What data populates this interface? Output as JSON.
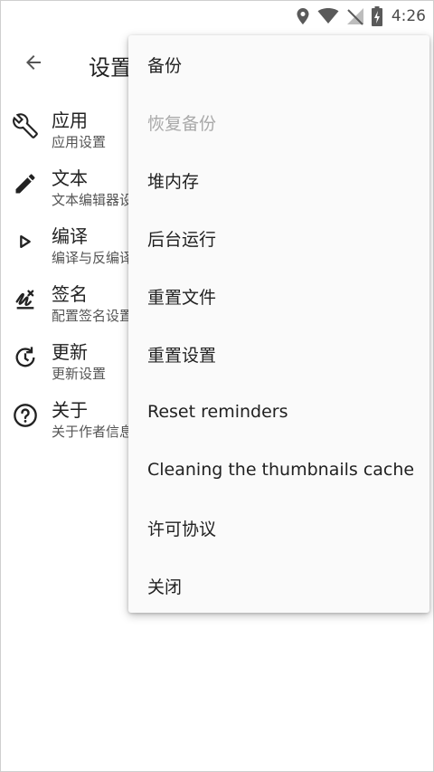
{
  "status_bar": {
    "time": "4:26",
    "icons": [
      "location-icon",
      "wifi-icon",
      "no-signal-icon",
      "battery-charging-icon"
    ]
  },
  "app_bar": {
    "back_icon": "arrow-back-icon",
    "title": "设置"
  },
  "settings": [
    {
      "icon": "wrench-icon",
      "title": "应用",
      "subtitle": "应用设置"
    },
    {
      "icon": "pencil-icon",
      "title": "文本",
      "subtitle": "文本编辑器设置"
    },
    {
      "icon": "play-icon",
      "title": "编译",
      "subtitle": "编译与反编译"
    },
    {
      "icon": "signature-icon",
      "title": "签名",
      "subtitle": "配置签名设置"
    },
    {
      "icon": "update-icon",
      "title": "更新",
      "subtitle": "更新设置"
    },
    {
      "icon": "help-icon",
      "title": "关于",
      "subtitle": "关于作者信息"
    }
  ],
  "menu": {
    "items": [
      {
        "label": "备份",
        "enabled": true
      },
      {
        "label": "恢复备份",
        "enabled": false
      },
      {
        "label": "堆内存",
        "enabled": true
      },
      {
        "label": "后台运行",
        "enabled": true
      },
      {
        "label": "重置文件",
        "enabled": true
      },
      {
        "label": "重置设置",
        "enabled": true
      },
      {
        "label": "Reset reminders",
        "enabled": true
      },
      {
        "label": "Cleaning the thumbnails cache",
        "enabled": true
      },
      {
        "label": "许可协议",
        "enabled": true
      },
      {
        "label": "关闭",
        "enabled": true
      }
    ]
  },
  "colors": {
    "menu_background": "#fafafa",
    "disabled_text": "#a9a9a9",
    "primary_text": "#212121"
  }
}
